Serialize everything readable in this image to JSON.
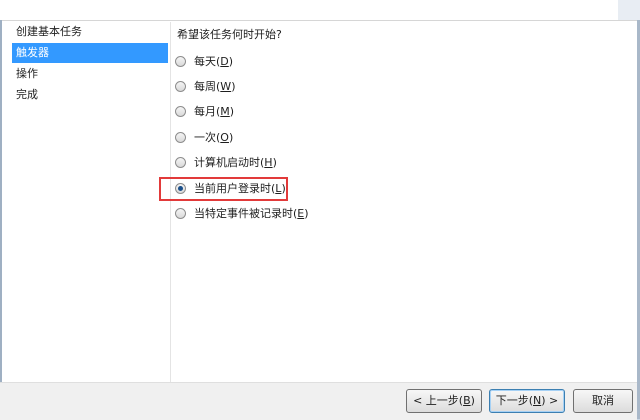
{
  "sidebar": {
    "items": [
      {
        "label": "创建基本任务",
        "active": false
      },
      {
        "label": "触发器",
        "active": true
      },
      {
        "label": "操作",
        "active": false
      },
      {
        "label": "完成",
        "active": false
      }
    ]
  },
  "main": {
    "question": "希望该任务何时开始?",
    "options": [
      {
        "label": "每天(",
        "hotkey": "D",
        "suffix": ")",
        "checked": false
      },
      {
        "label": "每周(",
        "hotkey": "W",
        "suffix": ")",
        "checked": false
      },
      {
        "label": "每月(",
        "hotkey": "M",
        "suffix": ")",
        "checked": false
      },
      {
        "label": "一次(",
        "hotkey": "O",
        "suffix": ")",
        "checked": false
      },
      {
        "label": "计算机启动时(",
        "hotkey": "H",
        "suffix": ")",
        "checked": false
      },
      {
        "label": "当前用户登录时(",
        "hotkey": "L",
        "suffix": ")",
        "checked": true
      },
      {
        "label": "当特定事件被记录时(",
        "hotkey": "E",
        "suffix": ")",
        "checked": false
      }
    ]
  },
  "footer": {
    "back": {
      "label": "< 上一步(",
      "hotkey": "B",
      "suffix": ")"
    },
    "next": {
      "label": "下一步(",
      "hotkey": "N",
      "suffix": ") >"
    },
    "cancel": {
      "label": "取消"
    }
  },
  "colors": {
    "active_step": "#3399ff",
    "highlight_box": "#e23a3a"
  }
}
